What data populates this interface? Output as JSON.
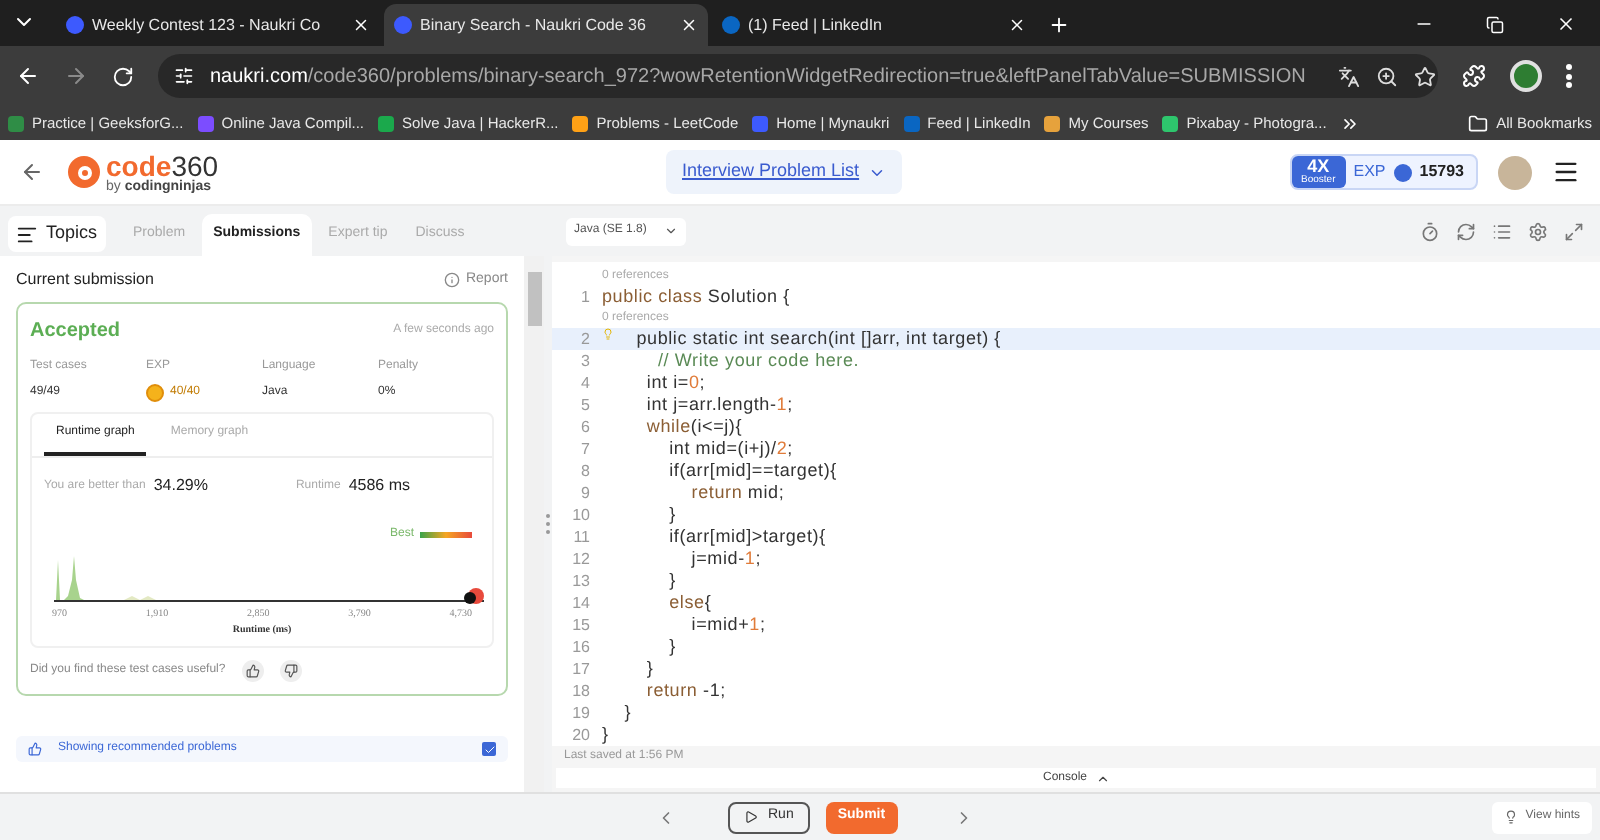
{
  "browser": {
    "tabs": [
      {
        "title": "Weekly Contest 123 - Naukri Co",
        "selected": false,
        "color": "#3d5afe"
      },
      {
        "title": "Binary Search - Naukri Code 36",
        "selected": true,
        "color": "#3d5afe"
      },
      {
        "title": "(1) Feed | LinkedIn",
        "selected": false,
        "color": "#0a66c2"
      }
    ],
    "url": {
      "domain": "naukri.com",
      "path": "/code360/problems/binary-search_972?wowRetentionWidgetRedirection=true&leftPanelTabValue=SUBMISSION"
    },
    "bookmarks": [
      {
        "label": "Practice | GeeksforG...",
        "color": "#2f8d46"
      },
      {
        "label": "Online Java Compil...",
        "color": "#7c4dff"
      },
      {
        "label": "Solve Java | HackerR...",
        "color": "#1ba94c"
      },
      {
        "label": "Problems - LeetCode",
        "color": "#ffa116"
      },
      {
        "label": "Home | Mynaukri",
        "color": "#3d5afe"
      },
      {
        "label": "Feed | LinkedIn",
        "color": "#0a66c2"
      },
      {
        "label": "My Courses",
        "color": "#e6a23c"
      },
      {
        "label": "Pixabay - Photogra...",
        "color": "#2ec66d"
      }
    ],
    "all_bookmarks": "All Bookmarks"
  },
  "header": {
    "logo": {
      "name": "code",
      "number": "360",
      "tagline_prefix": "by ",
      "tagline": "codingninjas"
    },
    "problem_list": "Interview Problem List",
    "booster": {
      "multiplier": "4X",
      "label": "Booster"
    },
    "exp_label": "EXP",
    "exp": "15793"
  },
  "toolbar": {
    "topics": "Topics",
    "tabs": [
      {
        "label": "Problem",
        "selected": false
      },
      {
        "label": "Submissions",
        "selected": true
      },
      {
        "label": "Expert tip",
        "selected": false
      },
      {
        "label": "Discuss",
        "selected": false
      }
    ],
    "language": "Java (SE 1.8)"
  },
  "submission": {
    "title": "Current submission",
    "report": "Report",
    "status": "Accepted",
    "time": "A few seconds ago",
    "stats": [
      {
        "label": "Test cases",
        "value": "49/49",
        "kind": "plain"
      },
      {
        "label": "EXP",
        "value": "40/40",
        "kind": "coin"
      },
      {
        "label": "Language",
        "value": "Java",
        "kind": "plain"
      },
      {
        "label": "Penalty",
        "value": "0%",
        "kind": "plain"
      }
    ],
    "graph_tabs": [
      {
        "label": "Runtime graph",
        "selected": true
      },
      {
        "label": "Memory graph",
        "selected": false
      }
    ],
    "better_label": "You are better than",
    "better_value": "34.29%",
    "runtime_label": "Runtime",
    "runtime_value": "4586 ms",
    "legend": "Best",
    "x_ticks": [
      "970",
      "1,910",
      "2,850",
      "3,790",
      "4,730"
    ],
    "xlabel": "Runtime (ms)",
    "feedback": "Did you find these test cases useful?",
    "recommended": {
      "label": "Showing recommended problems",
      "checked": true
    }
  },
  "editor": {
    "lines": [
      {
        "number": "1",
        "references": "0 references",
        "highlighted": false,
        "tokens": [
          {
            "kind": "kw",
            "text": "public class "
          },
          {
            "kind": "plain",
            "text": "Solution {"
          }
        ]
      },
      {
        "number": "2",
        "references": "0 references",
        "highlighted": true,
        "tokens": [
          {
            "kind": "plain",
            "text": "    public static int search(int []arr, int target) {"
          }
        ]
      },
      {
        "number": "3",
        "highlighted": false,
        "tokens": [
          {
            "kind": "comment",
            "text": "          // Write your code here."
          }
        ]
      },
      {
        "number": "4",
        "highlighted": false,
        "tokens": [
          {
            "kind": "plain",
            "text": "        int i="
          },
          {
            "kind": "num",
            "text": "0"
          },
          {
            "kind": "plain",
            "text": ";"
          }
        ]
      },
      {
        "number": "5",
        "highlighted": false,
        "tokens": [
          {
            "kind": "plain",
            "text": "        int j=arr.length-"
          },
          {
            "kind": "num",
            "text": "1"
          },
          {
            "kind": "plain",
            "text": ";"
          }
        ]
      },
      {
        "number": "6",
        "highlighted": false,
        "tokens": [
          {
            "kind": "kw",
            "text": "        while"
          },
          {
            "kind": "plain",
            "text": "(i<=j){"
          }
        ]
      },
      {
        "number": "7",
        "highlighted": false,
        "tokens": [
          {
            "kind": "plain",
            "text": "            int mid=(i+j)/"
          },
          {
            "kind": "num",
            "text": "2"
          },
          {
            "kind": "plain",
            "text": ";"
          }
        ]
      },
      {
        "number": "8",
        "highlighted": false,
        "tokens": [
          {
            "kind": "plain",
            "text": "            if(arr[mid]==target){"
          }
        ]
      },
      {
        "number": "9",
        "highlighted": false,
        "tokens": [
          {
            "kind": "kw",
            "text": "                return "
          },
          {
            "kind": "plain",
            "text": "mid;"
          }
        ]
      },
      {
        "number": "10",
        "highlighted": false,
        "tokens": [
          {
            "kind": "plain",
            "text": "            }"
          }
        ]
      },
      {
        "number": "11",
        "highlighted": false,
        "tokens": [
          {
            "kind": "plain",
            "text": "            if(arr[mid]>target){"
          }
        ]
      },
      {
        "number": "12",
        "highlighted": false,
        "tokens": [
          {
            "kind": "plain",
            "text": "                j=mid-"
          },
          {
            "kind": "num",
            "text": "1"
          },
          {
            "kind": "plain",
            "text": ";"
          }
        ]
      },
      {
        "number": "13",
        "highlighted": false,
        "tokens": [
          {
            "kind": "plain",
            "text": "            }"
          }
        ]
      },
      {
        "number": "14",
        "highlighted": false,
        "tokens": [
          {
            "kind": "kw",
            "text": "            else"
          },
          {
            "kind": "plain",
            "text": "{"
          }
        ]
      },
      {
        "number": "15",
        "highlighted": false,
        "tokens": [
          {
            "kind": "plain",
            "text": "                i=mid+"
          },
          {
            "kind": "num",
            "text": "1"
          },
          {
            "kind": "plain",
            "text": ";"
          }
        ]
      },
      {
        "number": "16",
        "highlighted": false,
        "tokens": [
          {
            "kind": "plain",
            "text": "            }"
          }
        ]
      },
      {
        "number": "17",
        "highlighted": false,
        "tokens": [
          {
            "kind": "plain",
            "text": "        }"
          }
        ]
      },
      {
        "number": "18",
        "highlighted": false,
        "tokens": [
          {
            "kind": "kw",
            "text": "        return "
          },
          {
            "kind": "plain",
            "text": "-1;"
          }
        ]
      },
      {
        "number": "19",
        "highlighted": false,
        "tokens": [
          {
            "kind": "plain",
            "text": "    }"
          }
        ]
      },
      {
        "number": "20",
        "highlighted": false,
        "tokens": [
          {
            "kind": "plain",
            "text": "}"
          }
        ]
      }
    ],
    "saved": "Last saved at 1:56 PM",
    "console": "Console"
  },
  "footer": {
    "run": "Run",
    "submit": "Submit",
    "hints": "View hints"
  }
}
